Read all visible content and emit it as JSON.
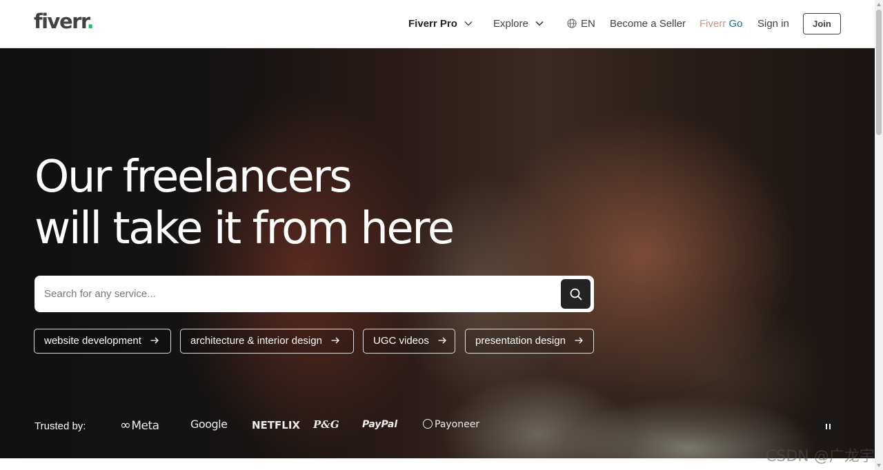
{
  "header": {
    "logo_text": "fiverr",
    "logo_dot": ".",
    "nav": {
      "fiverr_pro": "Fiverr Pro",
      "explore": "Explore",
      "language": "EN",
      "become_seller": "Become a Seller",
      "fiverr_go_part1": "Fiverr",
      "fiverr_go_part2": " Go",
      "sign_in": "Sign in",
      "join": "Join"
    }
  },
  "hero": {
    "title_line1": "Our freelancers",
    "title_line2": "will take it from here",
    "search": {
      "placeholder": "Search for any service..."
    },
    "suggestions": [
      {
        "label": "website development"
      },
      {
        "label": "architecture & interior design"
      },
      {
        "label": "UGC videos"
      },
      {
        "label": "presentation design"
      }
    ],
    "trusted_by": {
      "label": "Trusted by:",
      "brands": [
        "Meta",
        "Google",
        "NETFLIX",
        "P&G",
        "PayPal",
        "Payoneer"
      ]
    }
  },
  "watermark": "CSDN @广龙宇",
  "colors": {
    "brand_green": "#1dbf73",
    "text_dark": "#404145",
    "go_accent": "#1c6a8a"
  }
}
